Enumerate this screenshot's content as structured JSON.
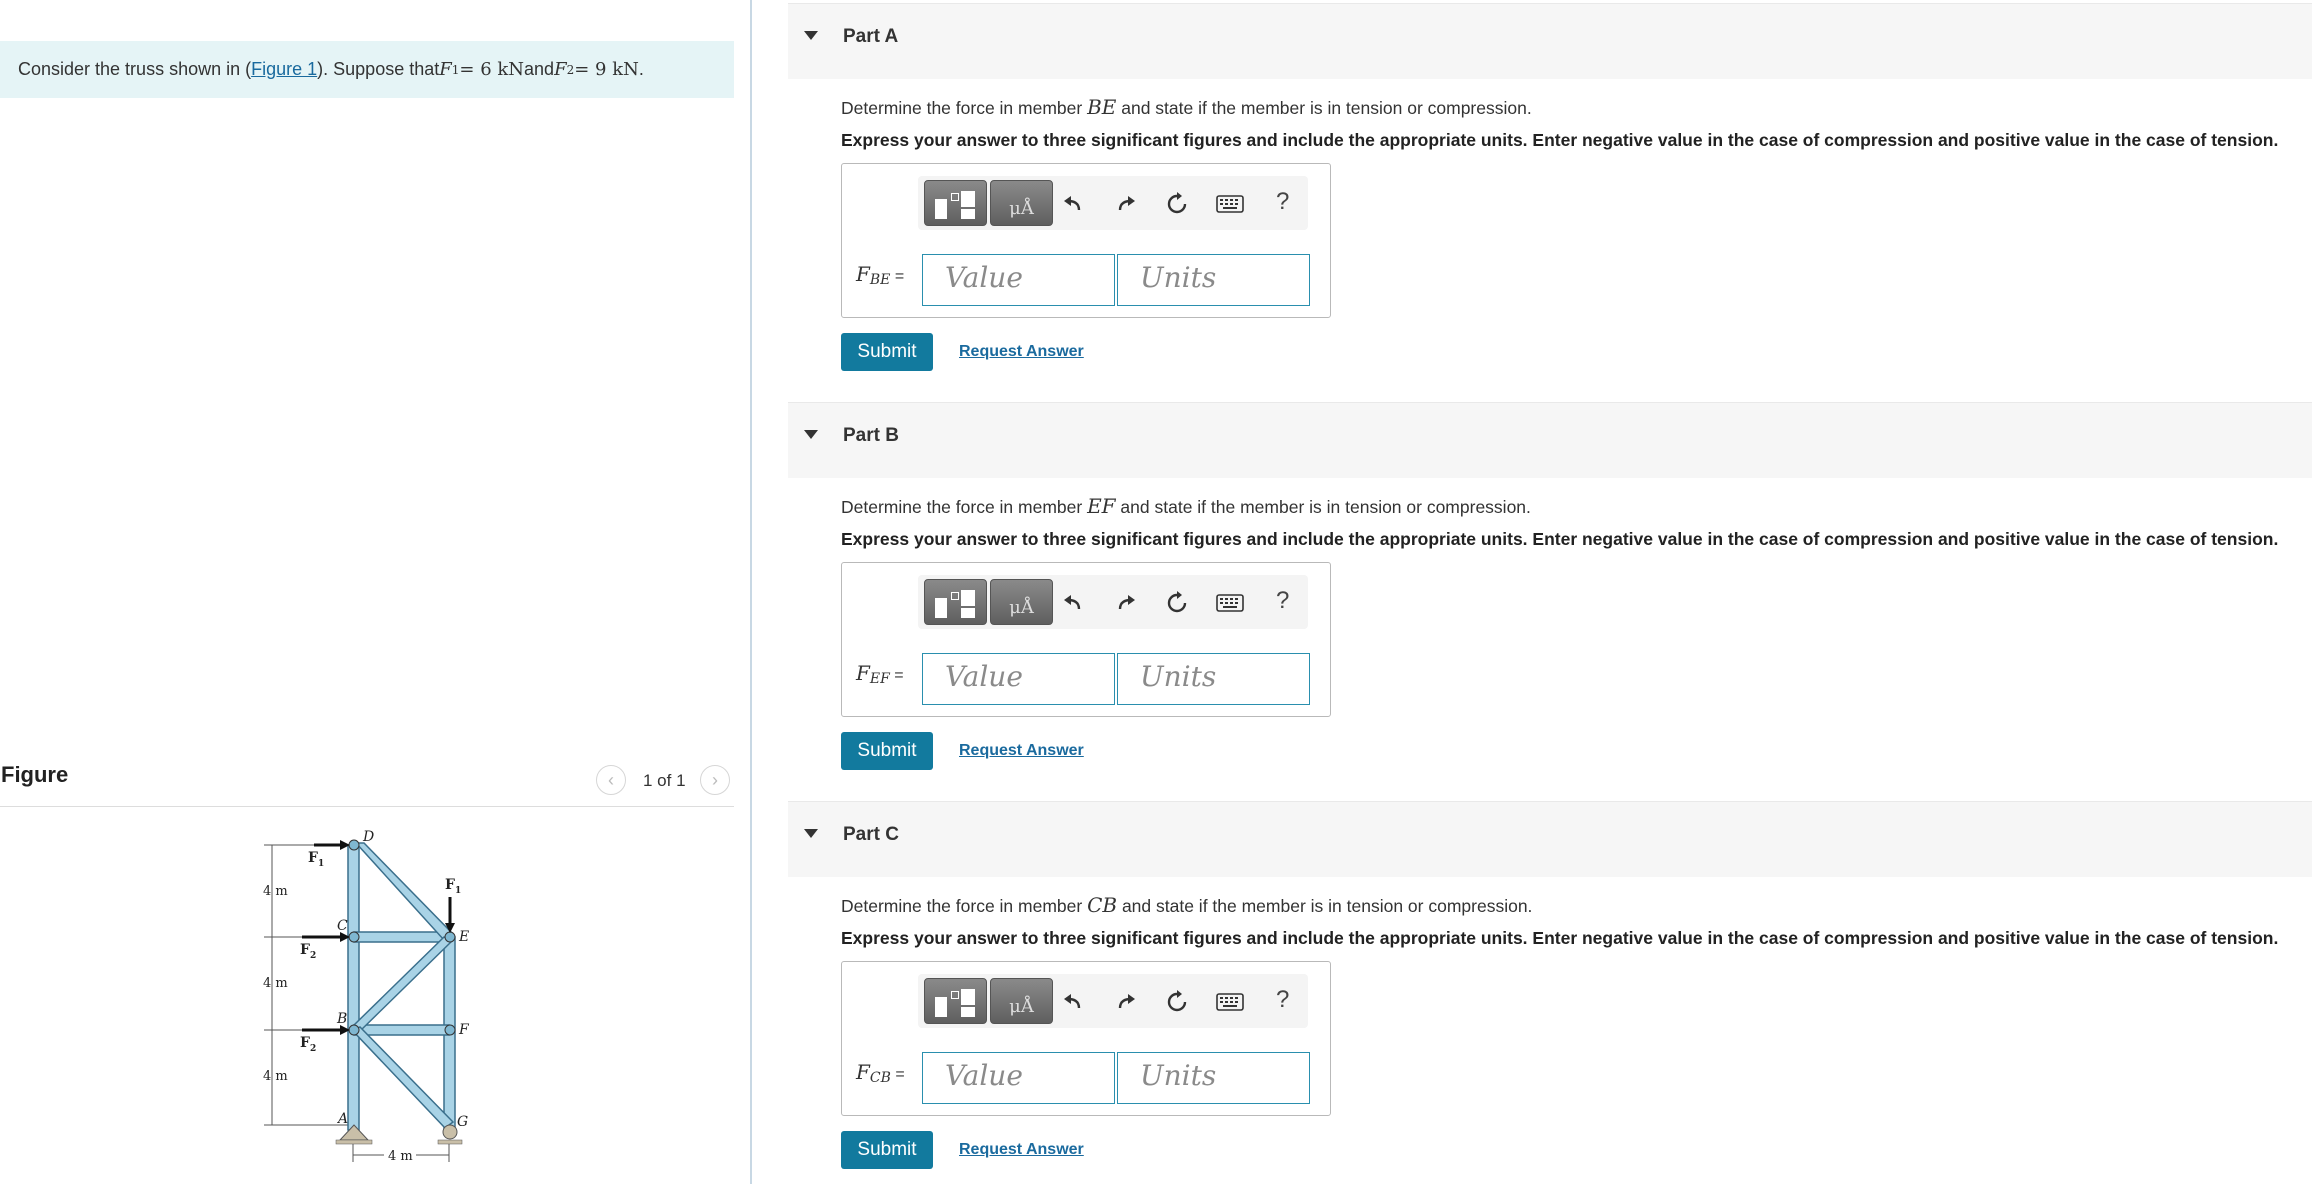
{
  "problem": {
    "prefix": "Consider the truss shown in (",
    "figure_link": "Figure 1",
    "middle": "). Suppose that ",
    "f1_symbol": "F",
    "f1_sub": "1",
    "f1_value": " = 6  kN",
    "and_text": " and ",
    "f2_symbol": "F",
    "f2_sub": "2",
    "f2_value": " = 9  kN",
    "end": " ."
  },
  "figure_panel": {
    "title": "Figure",
    "counter": "1 of 1",
    "prev_icon": "chevron-left-icon",
    "next_icon": "chevron-right-icon",
    "labels": {
      "D": "D",
      "C": "C",
      "B": "B",
      "A": "A",
      "E": "E",
      "F": "F",
      "G": "G",
      "F1_left": "F",
      "F1_left_sub": "1",
      "F1_right": "F",
      "F1_right_sub": "1",
      "F2_upper": "F",
      "F2_upper_sub": "2",
      "F2_lower": "F",
      "F2_lower_sub": "2",
      "dim_1": "4 m",
      "dim_2": "4 m",
      "dim_3": "4 m",
      "dim_bottom": "4 m"
    }
  },
  "toolbar": {
    "template_icon": "templates-icon",
    "units_label": "μÅ",
    "undo_icon": "undo-icon",
    "redo_icon": "redo-icon",
    "reset_icon": "reset-icon",
    "keyboard_icon": "keyboard-icon",
    "help_label": "?"
  },
  "parts": [
    {
      "title": "Part A",
      "question_pre": "Determine the force in member ",
      "member": "BE",
      "question_post": " and state if the member is in tension or compression.",
      "instruction": "Express your answer to three significant figures and include the appropriate units. Enter negative value in the case of compression and positive value in the case of tension.",
      "label_main": "F",
      "label_sub": "BE",
      "label_eq": " =",
      "value_placeholder": "Value",
      "units_placeholder": "Units",
      "submit": "Submit",
      "request": "Request Answer"
    },
    {
      "title": "Part B",
      "question_pre": "Determine the force in member ",
      "member": "EF",
      "question_post": " and state if the member is in tension or compression.",
      "instruction": "Express your answer to three significant figures and include the appropriate units. Enter negative value in the case of compression and positive value in the case of tension.",
      "label_main": "F",
      "label_sub": "EF",
      "label_eq": " =",
      "value_placeholder": "Value",
      "units_placeholder": "Units",
      "submit": "Submit",
      "request": "Request Answer"
    },
    {
      "title": "Part C",
      "question_pre": "Determine the force in member ",
      "member": "CB",
      "question_post": " and state if the member is in tension or compression.",
      "instruction": "Express your answer to three significant figures and include the appropriate units. Enter negative value in the case of compression and positive value in the case of tension.",
      "label_main": "F",
      "label_sub": "CB",
      "label_eq": " =",
      "value_placeholder": "Value",
      "units_placeholder": "Units",
      "submit": "Submit",
      "request": "Request Answer"
    }
  ],
  "colors": {
    "accent": "#127a9e",
    "link": "#1a6a9e",
    "banner_bg": "#e5f4f6",
    "truss_fill": "#a9d3e6",
    "truss_stroke": "#3a6f8c"
  }
}
